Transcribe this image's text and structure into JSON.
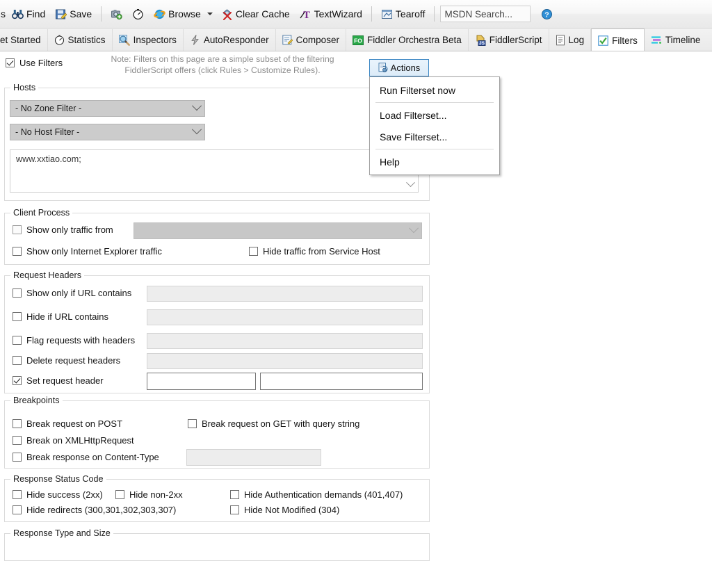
{
  "toolbar": {
    "items": [
      {
        "icon": "binoculars-icon",
        "label": "Find",
        "name": "toolbar-find"
      },
      {
        "icon": "save-icon",
        "label": "Save",
        "name": "toolbar-save"
      },
      {
        "icon": "sep",
        "label": "",
        "name": "toolbar-separator-1"
      },
      {
        "icon": "camera-icon",
        "label": "",
        "name": "toolbar-screenshot"
      },
      {
        "icon": "timer-icon",
        "label": "",
        "name": "toolbar-timer"
      },
      {
        "icon": "browse-icon",
        "label": "Browse",
        "name": "toolbar-browse"
      },
      {
        "icon": "caret",
        "label": "",
        "name": "toolbar-browse-dropdown"
      },
      {
        "icon": "clear-cache-icon",
        "label": "Clear Cache",
        "name": "toolbar-clear-cache"
      },
      {
        "icon": "textwizard-icon",
        "label": "TextWizard",
        "name": "toolbar-textwizard"
      },
      {
        "icon": "sep",
        "label": "",
        "name": "toolbar-separator-2"
      },
      {
        "icon": "tearoff-icon",
        "label": "Tearoff",
        "name": "toolbar-tearoff"
      },
      {
        "icon": "sep",
        "label": "",
        "name": "toolbar-separator-3"
      }
    ],
    "search_placeholder": "MSDN Search...",
    "help_icon": "help-icon"
  },
  "tabs": [
    {
      "label": "et Started",
      "icon": "get-started-icon",
      "active": false,
      "name": "tab-get-started"
    },
    {
      "label": "Statistics",
      "icon": "statistics-icon",
      "active": false,
      "name": "tab-statistics"
    },
    {
      "label": "Inspectors",
      "icon": "inspectors-icon",
      "active": false,
      "name": "tab-inspectors"
    },
    {
      "label": "AutoResponder",
      "icon": "autoresponder-icon",
      "active": false,
      "name": "tab-autoresponder"
    },
    {
      "label": "Composer",
      "icon": "composer-icon",
      "active": false,
      "name": "tab-composer"
    },
    {
      "label": "Fiddler Orchestra Beta",
      "icon": "fiddler-orchestra-icon",
      "active": false,
      "name": "tab-fiddler-orchestra"
    },
    {
      "label": "FiddlerScript",
      "icon": "fiddlerscript-icon",
      "active": false,
      "name": "tab-fiddlerscript"
    },
    {
      "label": "Log",
      "icon": "log-icon",
      "active": false,
      "name": "tab-log"
    },
    {
      "label": "Filters",
      "icon": "filters-icon",
      "active": true,
      "name": "tab-filters"
    },
    {
      "label": "Timeline",
      "icon": "timeline-icon",
      "active": false,
      "name": "tab-timeline"
    }
  ],
  "filters": {
    "use_filters_label": "Use Filters",
    "use_filters_checked": true,
    "note_line1": "Note: Filters on this page are a simple subset of the filtering",
    "note_line2": "FiddlerScript offers (click Rules > Customize Rules).",
    "actions_button_label": "Actions",
    "actions_menu": [
      {
        "label": "Run Filterset now",
        "name": "menu-run-filterset-now"
      },
      {
        "label": "Load Filterset...",
        "name": "menu-load-filterset"
      },
      {
        "label": "Save Filterset...",
        "name": "menu-save-filterset"
      },
      {
        "label": "Help",
        "name": "menu-help"
      }
    ],
    "hosts": {
      "title": "Hosts",
      "zone_filter_value": "- No Zone Filter -",
      "host_filter_value": "- No Host Filter -",
      "hosts_text": "www.xxtiao.com;"
    },
    "client_process": {
      "title": "Client Process",
      "show_only_traffic_from_label": "Show only traffic from",
      "show_only_traffic_from_checked": false,
      "process_combo_value": "",
      "show_only_ie_label": "Show only Internet Explorer traffic",
      "show_only_ie_checked": false,
      "hide_service_host_label": "Hide traffic from Service Host",
      "hide_service_host_checked": false
    },
    "request_headers": {
      "title": "Request Headers",
      "rows": [
        {
          "label": "Show only if URL contains",
          "checked": false,
          "value": "",
          "enabled": false,
          "name": "show-only-if-url-contains"
        },
        {
          "label": "Hide if URL contains",
          "checked": false,
          "value": "",
          "enabled": false,
          "name": "hide-if-url-contains"
        },
        {
          "label": "Flag requests with headers",
          "checked": false,
          "value": "",
          "enabled": false,
          "name": "flag-requests-with-headers"
        },
        {
          "label": "Delete request headers",
          "checked": false,
          "value": "",
          "enabled": false,
          "name": "delete-request-headers"
        },
        {
          "label": "Set request header",
          "checked": true,
          "value": "",
          "value2": "",
          "enabled": true,
          "name": "set-request-header"
        }
      ]
    },
    "breakpoints": {
      "title": "Breakpoints",
      "break_request_on_post_label": "Break request on POST",
      "break_request_on_post_checked": false,
      "break_request_on_get_label": "Break request on GET with query string",
      "break_request_on_get_checked": false,
      "break_on_xhr_label": "Break on XMLHttpRequest",
      "break_on_xhr_checked": false,
      "break_response_on_content_type_label": "Break response on Content-Type",
      "break_response_on_content_type_checked": false,
      "content_type_value": ""
    },
    "response_status": {
      "title": "Response Status Code",
      "hide_success_label": "Hide success (2xx)",
      "hide_success_checked": false,
      "hide_non2xx_label": "Hide non-2xx",
      "hide_non2xx_checked": false,
      "hide_auth_label": "Hide Authentication demands (401,407)",
      "hide_auth_checked": false,
      "hide_redirects_label": "Hide redirects (300,301,302,303,307)",
      "hide_redirects_checked": false,
      "hide_not_modified_label": "Hide Not Modified (304)",
      "hide_not_modified_checked": false
    },
    "response_type": {
      "title": "Response Type and Size"
    }
  },
  "colors": {
    "accent": "#3c87c4",
    "tab_active_bg": "#ffffff",
    "note_text": "#8d8d8d",
    "group_border": "#dadada"
  }
}
